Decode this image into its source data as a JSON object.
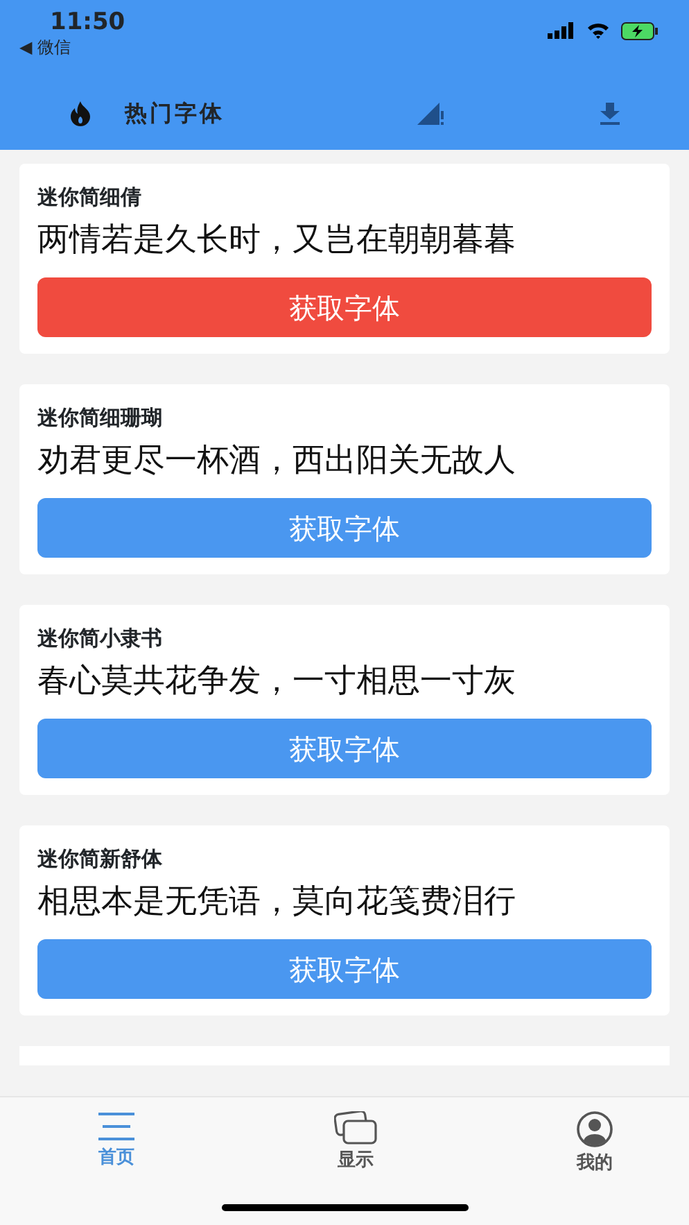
{
  "status_bar": {
    "time": "11:50",
    "back_arrow": "◀",
    "back_label": "微信"
  },
  "nav_bar": {
    "title": "热门字体"
  },
  "fonts": [
    {
      "name": "迷你简细倩",
      "sample": "两情若是久长时，又岂在朝朝暮暮",
      "button": "获取字体",
      "color": "#f04b3f"
    },
    {
      "name": "迷你简细珊瑚",
      "sample": "劝君更尽一杯酒，西出阳关无故人",
      "button": "获取字体",
      "color": "#4a97f0"
    },
    {
      "name": "迷你简小隶书",
      "sample": "春心莫共花争发，一寸相思一寸灰",
      "button": "获取字体",
      "color": "#4a97f0"
    },
    {
      "name": "迷你简新舒体",
      "sample": "相思本是无凭语，莫向花笺费泪行",
      "button": "获取字体",
      "color": "#4a97f0"
    }
  ],
  "tab_bar": [
    {
      "kind": "home",
      "label": "首页",
      "selected": true
    },
    {
      "kind": "display",
      "label": "显示",
      "selected": false
    },
    {
      "kind": "mine",
      "label": "我的",
      "selected": false
    }
  ]
}
